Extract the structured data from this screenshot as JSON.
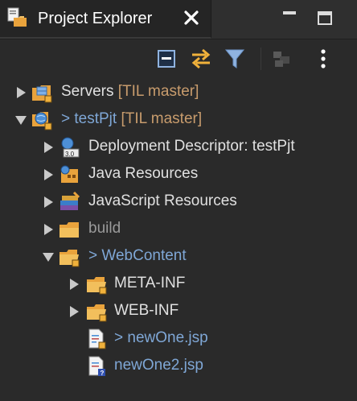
{
  "view": {
    "title": "Project Explorer",
    "tab_icon": "project-explorer-icon",
    "close_icon": "close-icon",
    "minimize_icon": "minimize-icon",
    "maximize_icon": "maximize-icon"
  },
  "toolbar": {
    "collapse_all_icon": "collapse-all-icon",
    "link_with_editor_icon": "link-with-editor-icon",
    "filter_icon": "filter-icon",
    "focus_icon": "focus-on-working-set-icon",
    "menu_icon": "view-menu-icon"
  },
  "tree": {
    "items": [
      {
        "label": "Servers",
        "prefix": "",
        "decoration": "[TIL master]",
        "icon": "server-folder-icon",
        "expanded": false
      },
      {
        "label": "testPjt",
        "prefix": "> ",
        "decoration": "[TIL master]",
        "icon": "web-project-icon",
        "expanded": true
      },
      {
        "label": "Deployment Descriptor: testPjt",
        "prefix": "",
        "decoration": "",
        "icon": "deployment-descriptor-icon",
        "expanded": false
      },
      {
        "label": "Java Resources",
        "prefix": "",
        "decoration": "",
        "icon": "java-resources-icon",
        "expanded": false
      },
      {
        "label": "JavaScript Resources",
        "prefix": "",
        "decoration": "",
        "icon": "javascript-resources-icon",
        "expanded": false
      },
      {
        "label": "build",
        "prefix": "",
        "decoration": "",
        "icon": "folder-icon",
        "expanded": false
      },
      {
        "label": "WebContent",
        "prefix": "> ",
        "decoration": "",
        "icon": "folder-open-icon",
        "expanded": true
      },
      {
        "label": "META-INF",
        "prefix": "",
        "decoration": "",
        "icon": "folder-icon",
        "expanded": false
      },
      {
        "label": "WEB-INF",
        "prefix": "",
        "decoration": "",
        "icon": "folder-icon",
        "expanded": false
      },
      {
        "label": "newOne.jsp",
        "prefix": "> ",
        "decoration": "",
        "icon": "jsp-file-icon"
      },
      {
        "label": "newOne2.jsp",
        "prefix": "",
        "decoration": "",
        "icon": "jsp-file-untracked-icon"
      }
    ]
  },
  "colors": {
    "background": "#2a2a2a",
    "text": "#e0e0e0",
    "git_decoration": "#c89c6d",
    "changed_prefix": "#7fa7d6",
    "folder": "#e9a33c"
  }
}
